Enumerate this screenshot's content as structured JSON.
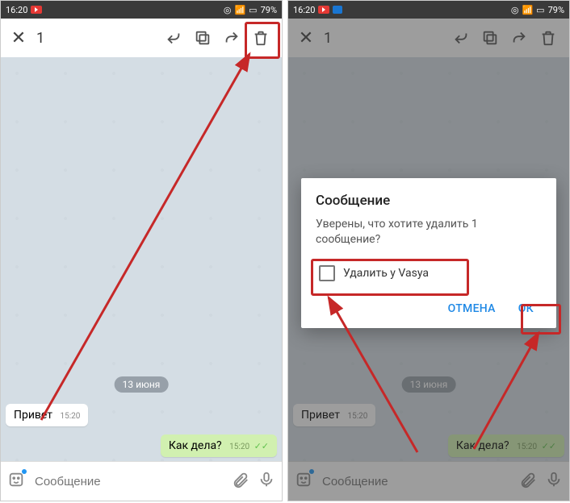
{
  "status": {
    "time": "16:20",
    "battery": "79%"
  },
  "toolbar": {
    "selected_count": "1"
  },
  "chat": {
    "date_chip": "13 июня",
    "msg_in_text": "Привет",
    "msg_in_time": "15:20",
    "msg_out_text": "Как дела?",
    "msg_out_time": "15:20"
  },
  "input": {
    "placeholder": "Сообщение"
  },
  "dialog": {
    "title": "Сообщение",
    "body": "Уверены, что хотите удалить 1 сообщение?",
    "checkbox_label": "Удалить у Vasya",
    "cancel": "ОТМЕНА",
    "ok": "ОК"
  }
}
